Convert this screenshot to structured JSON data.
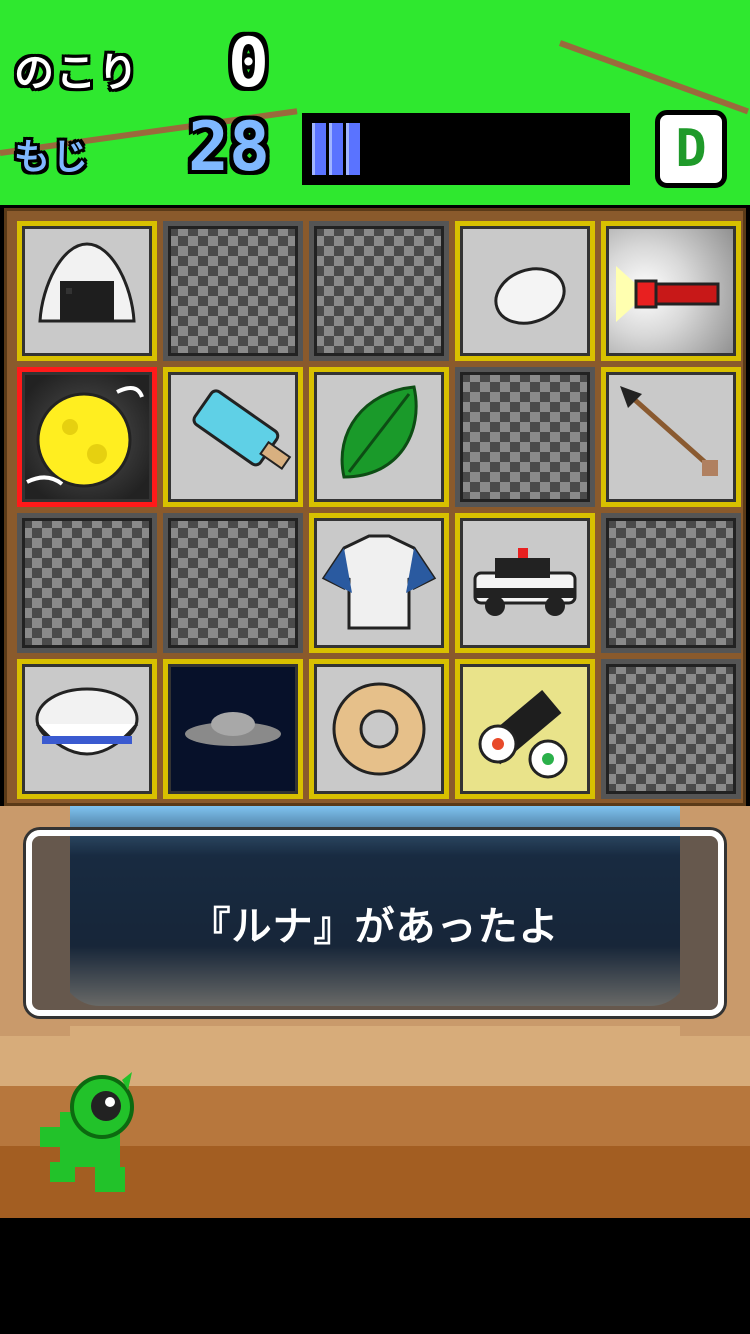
{
  "hud": {
    "remaining_label": "のこり",
    "remaining_value": "0",
    "letters_label": "もじ",
    "letters_value": "28",
    "letters_bar_level": 0.2,
    "rank": "D"
  },
  "grid": {
    "rows": [
      [
        {
          "state": "open",
          "icon": "onigiri-icon"
        },
        {
          "state": "hidden",
          "icon": "hidden-tile-icon"
        },
        {
          "state": "hidden",
          "icon": "hidden-tile-icon"
        },
        {
          "state": "open",
          "icon": "egg-icon"
        },
        {
          "state": "open",
          "icon": "flashlight-icon"
        }
      ],
      [
        {
          "state": "open",
          "icon": "moon-icon",
          "selected": true
        },
        {
          "state": "open",
          "icon": "ice-pop-icon"
        },
        {
          "state": "open",
          "icon": "leaf-icon"
        },
        {
          "state": "hidden",
          "icon": "hidden-tile-icon"
        },
        {
          "state": "open",
          "icon": "arrow-icon"
        }
      ],
      [
        {
          "state": "hidden",
          "icon": "hidden-tile-icon"
        },
        {
          "state": "hidden",
          "icon": "hidden-tile-icon"
        },
        {
          "state": "open",
          "icon": "shirt-icon"
        },
        {
          "state": "open",
          "icon": "police-car-icon"
        },
        {
          "state": "hidden",
          "icon": "hidden-tile-icon"
        }
      ],
      [
        {
          "state": "open",
          "icon": "rice-bowl-icon"
        },
        {
          "state": "open",
          "icon": "ufo-icon"
        },
        {
          "state": "open",
          "icon": "donut-icon"
        },
        {
          "state": "open",
          "icon": "sushi-roll-icon"
        },
        {
          "state": "hidden",
          "icon": "hidden-tile-icon"
        }
      ]
    ]
  },
  "dialog": {
    "message": "『ルナ』があったよ"
  },
  "colors": {
    "hud_green": "#2fe82f",
    "tile_border": "#d8c000",
    "selected_border": "#ff1a1a",
    "bar_blue": "#5a73ff",
    "rank_green": "#1f9a2a"
  }
}
